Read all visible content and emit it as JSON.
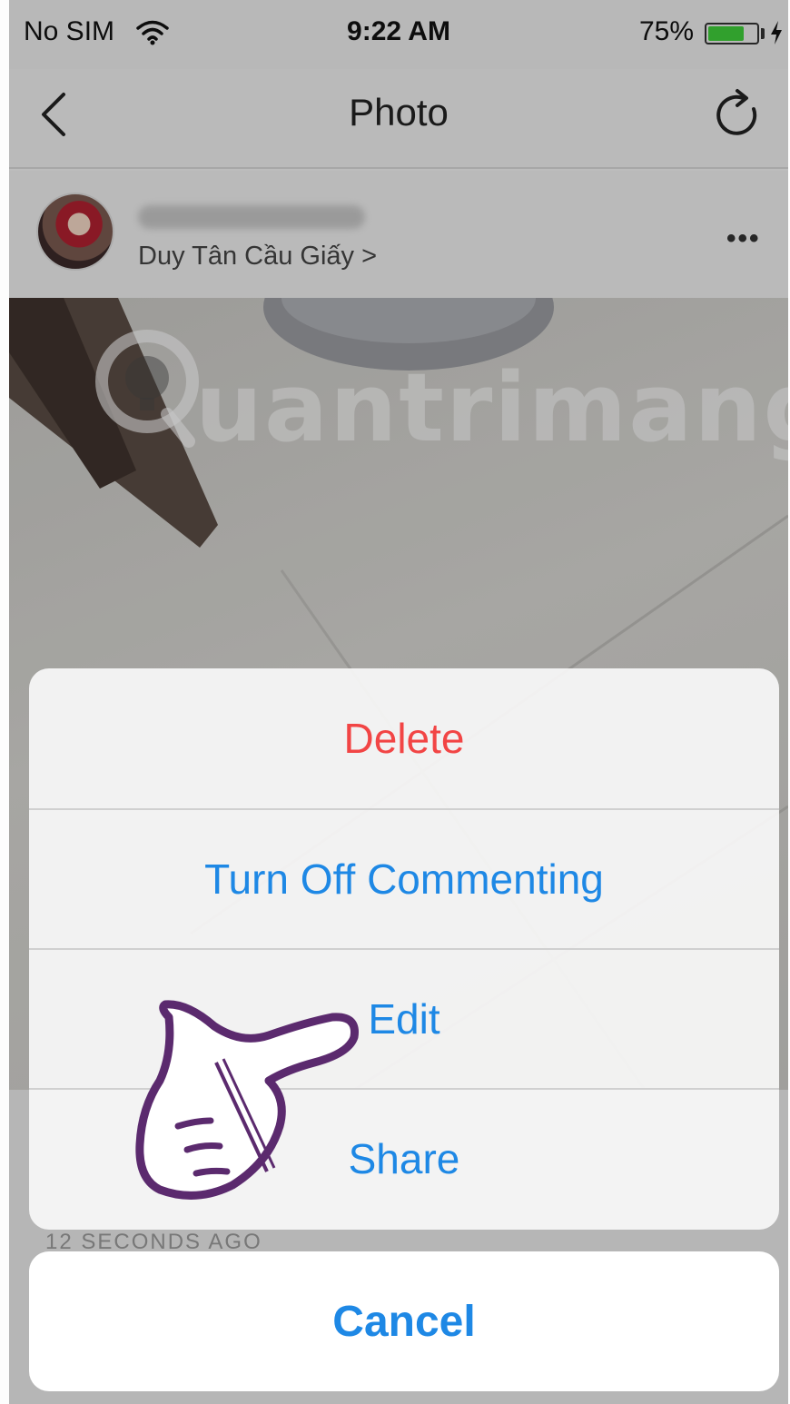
{
  "status_bar": {
    "carrier": "No SIM",
    "time": "9:22 AM",
    "battery": "75%",
    "battery_level": 0.75,
    "icons": [
      "wifi-icon",
      "battery-icon",
      "charging-icon"
    ]
  },
  "nav": {
    "title": "Photo",
    "icons": [
      "back-icon",
      "refresh-icon"
    ]
  },
  "post": {
    "location": "Duy Tân Cầu Giấy >",
    "more_icon": "•••",
    "timestamp": "12 SECONDS AGO"
  },
  "watermark": {
    "text": "uantrimang",
    "icon": "lightbulb-q-icon"
  },
  "action_sheet": {
    "items": [
      {
        "label": "Delete",
        "style": "destructive",
        "color": "#f24545"
      },
      {
        "label": "Turn Off Commenting",
        "style": "default",
        "color": "#1e88e5"
      },
      {
        "label": "Edit",
        "style": "default",
        "color": "#1e88e5"
      },
      {
        "label": "Share",
        "style": "default",
        "color": "#1e88e5"
      }
    ],
    "cancel": "Cancel"
  },
  "overlay": {
    "pointer_icon": "hand-pointer-icon",
    "pointer_color": "#5b2a6e"
  }
}
